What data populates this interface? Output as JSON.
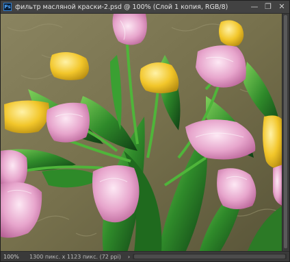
{
  "window": {
    "app_icon_label": "Ps",
    "title": "фильтр масляной краски-2.psd @ 100% (Слой 1 копия, RGB/8)",
    "minimize_glyph": "—",
    "restore_glyph": "❐",
    "close_glyph": "✕"
  },
  "canvas": {
    "image_subject": "oil-paint-tulips"
  },
  "status": {
    "zoom": "100%",
    "doc_info": "1300 пикс. x 1123 пикс. (72 ppi)",
    "nav_arrow": "›"
  },
  "colors": {
    "background": "#7e7a55",
    "leaf_green": "#2f8a2a",
    "tulip_pink": "#e8a7c9",
    "tulip_yellow": "#f2c828"
  }
}
